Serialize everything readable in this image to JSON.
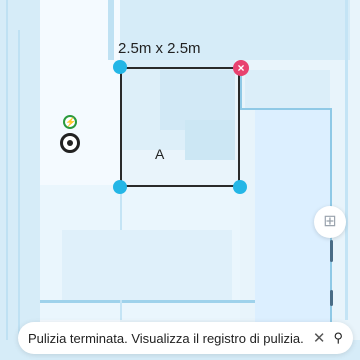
{
  "map": {
    "zone": {
      "size_label": "2.5m x 2.5m",
      "name": "A"
    },
    "dock_icon": "charging-dock-icon",
    "robot_icon": "robot-position-icon"
  },
  "controls": {
    "add_zone_icon": "add-zone-icon",
    "side_icons": [
      "dock-indicator-icon",
      "robot-indicator-icon"
    ]
  },
  "toast": {
    "message": "Pulizia terminata. Visualizza il registro di pulizia.",
    "close_icon": "close-icon"
  },
  "colors": {
    "background": "#e8f4fb",
    "room_fill": "#d6ecf8",
    "accent": "#24b6e6",
    "delete": "#e8426f"
  }
}
